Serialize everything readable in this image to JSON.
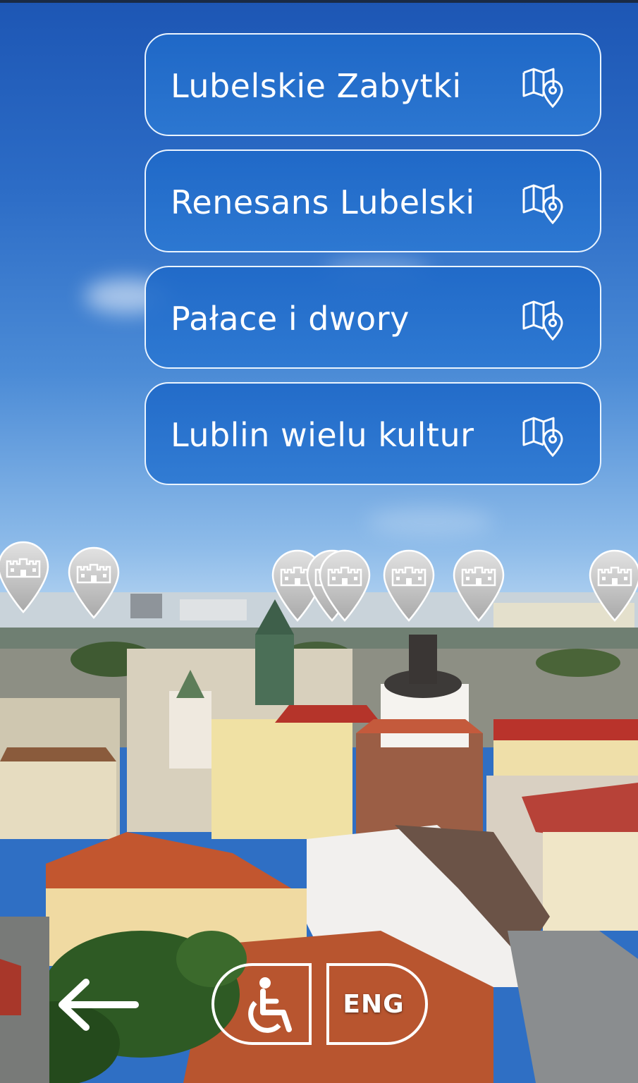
{
  "menu": {
    "items": [
      {
        "label": "Lubelskie Zabytki",
        "icon": "map-pin-icon"
      },
      {
        "label": "Renesans Lubelski",
        "icon": "map-pin-icon"
      },
      {
        "label": "Pałace i dwory",
        "icon": "map-pin-icon"
      },
      {
        "label": "Lublin wielu kultur",
        "icon": "map-pin-icon"
      }
    ]
  },
  "pins": {
    "icon": "castle-pin-icon",
    "count": 8
  },
  "controls": {
    "back_icon": "arrow-left-icon",
    "accessibility_icon": "wheelchair-icon",
    "language_label": "ENG"
  },
  "colors": {
    "button_fill": "#1f69c8",
    "button_border": "#eaf4ff",
    "text": "#ffffff",
    "pin_fill": "#c8c8c8"
  }
}
